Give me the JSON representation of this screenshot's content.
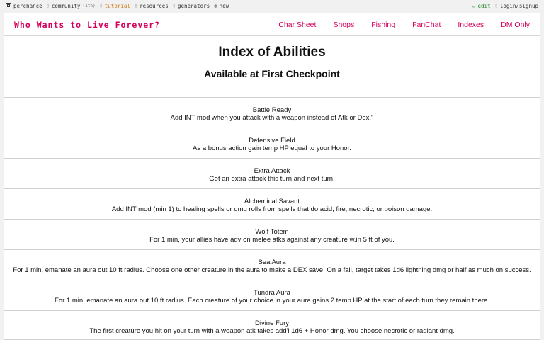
{
  "topbar": {
    "left": [
      {
        "icon": "perchance-logo-icon",
        "label": "perchance"
      },
      {
        "icon": "community-icon",
        "label": "community",
        "count": "(1th)"
      },
      {
        "icon": "tutorial-icon",
        "label": "tutorial"
      },
      {
        "icon": "resources-icon",
        "label": "resources"
      },
      {
        "icon": "generators-icon",
        "label": "generators"
      },
      {
        "icon": "plus-icon",
        "label": "new"
      }
    ],
    "right": [
      {
        "icon": "pencil-icon",
        "label": "edit"
      },
      {
        "icon": "user-icon",
        "label": "login/signup"
      }
    ],
    "colors": {
      "tutorial": "#d07a1a",
      "edit": "#2a8a2a"
    }
  },
  "site": {
    "title": "Who Wants to Live Forever?",
    "accent": "#d4005c",
    "nav": [
      "Char Sheet",
      "Shops",
      "Fishing",
      "FanChat",
      "Indexes",
      "DM Only"
    ]
  },
  "header": {
    "title": "Index of Abilities",
    "subtitle": "Available at First Checkpoint"
  },
  "abilities": [
    {
      "name": "Battle Ready",
      "desc": "Add INT mod when you attack with a weapon instead of Atk or Dex.\""
    },
    {
      "name": "Defensive Field",
      "desc": "As a bonus action gain temp HP equal to your Honor."
    },
    {
      "name": "Extra Attack",
      "desc": "Get an extra attack this turn and next turn."
    },
    {
      "name": "Alchemical Savant",
      "desc": "Add INT mod (min 1) to healing spells or dmg rolls from spells that do acid, fire, necrotic, or poison damage."
    },
    {
      "name": "Wolf Totem",
      "desc": "For 1 min, your allies have adv on melee atks against any creature w.in 5 ft of you."
    },
    {
      "name": "Sea Aura",
      "desc": "For 1 min, emanate an aura out 10 ft radius. Choose one other creature in the aura to make a DEX save. On a fail, target takes 1d6 lightning dmg or half as much on success."
    },
    {
      "name": "Tundra Aura",
      "desc": "For 1 min, emanate an aura out 10 ft radius. Each creature of your choice in your aura gains 2 temp HP at the start of each turn they remain there."
    },
    {
      "name": "Divine Fury",
      "desc": "The first creature you hit on your turn with a weapon atk takes add'l 1d6 + Honor dmg. You choose necrotic or radiant dmg."
    }
  ]
}
